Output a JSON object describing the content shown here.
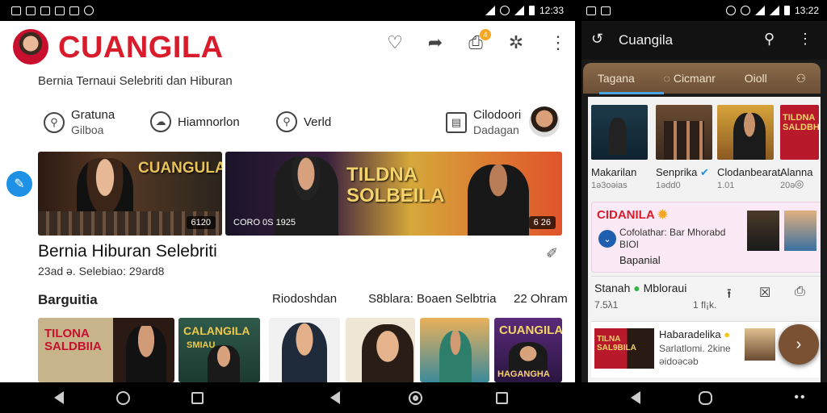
{
  "status_left": {
    "time": "12:33"
  },
  "status_right": {
    "time": "13:22"
  },
  "left_app": {
    "brand": "CUANGILA",
    "subtitle": "Bernia Ternaui Selebriti dan Hiburan",
    "notification_count": "4",
    "categories": [
      {
        "line1": "Gratuna",
        "line2": "Gilboa"
      },
      {
        "line1": "Hiamnorlon",
        "line2": ""
      },
      {
        "line1": "Verld",
        "line2": ""
      },
      {
        "line1": "Cilodoori",
        "line2": "Dadagan"
      }
    ],
    "banners": [
      {
        "title": "CUANGULA",
        "count": "6120"
      },
      {
        "title": "TILDNA SOLBEILA",
        "caption": "CORO 0S 1925",
        "count": "6 26"
      }
    ],
    "section_title": "Bernia Hiburan Selebriti",
    "section_meta": "23ad ə. Selebiao: 29ard8",
    "row_labels": [
      "Barguitia",
      "Riodoshdan",
      "S8blara: Boaen Selbtria",
      "22 Ohram"
    ],
    "thumbs": [
      {
        "title": "TILONA SALDBIIA"
      },
      {
        "title": "CALANGILA",
        "sub": "SMIAU"
      },
      {
        "title": ""
      },
      {
        "title": ""
      },
      {
        "title": ""
      },
      {
        "title": "CUANGILA",
        "sub": "HAGANGHA"
      }
    ]
  },
  "right_app": {
    "title": "Cuangila",
    "tabs": [
      "Tagana",
      "Cicmanr",
      "Oioll",
      ""
    ],
    "thumbs": [
      {
        "caption": "Makarilan",
        "sub": "1ә3oəias"
      },
      {
        "caption": "Senprika",
        "sub": "1ədd0"
      },
      {
        "caption": "Clodanbearat.",
        "sub": "1.01"
      },
      {
        "caption": "Alanna",
        "sub": "20ә"
      }
    ],
    "thumb4_title": "TILDNA SALDBHA",
    "card": {
      "title": "CIDANILA",
      "line1": "Cofolathar: Bar Mhorabd",
      "line2": "BIOI",
      "line3": "Bapanial"
    },
    "row2": {
      "title": "Stanah",
      "subtitle": "Mbloraui",
      "sub": "7.5λ1",
      "action": "1 fl¡k."
    },
    "row3": {
      "title": "Habaradelika",
      "line1": "Sarlatlomi. 2kine",
      "line2": "əidoəcәb",
      "thumb_title": "TILNA SAL9BILA"
    }
  },
  "colors": {
    "brand_red": "#d91c2b",
    "accent_blue": "#1e90e6",
    "tab_brown": "#7a5233"
  },
  "icons": [
    "heart-icon",
    "share-icon",
    "camera-icon",
    "settings-icon",
    "more-icon",
    "search-icon",
    "back-icon",
    "home-icon",
    "recents-icon"
  ]
}
